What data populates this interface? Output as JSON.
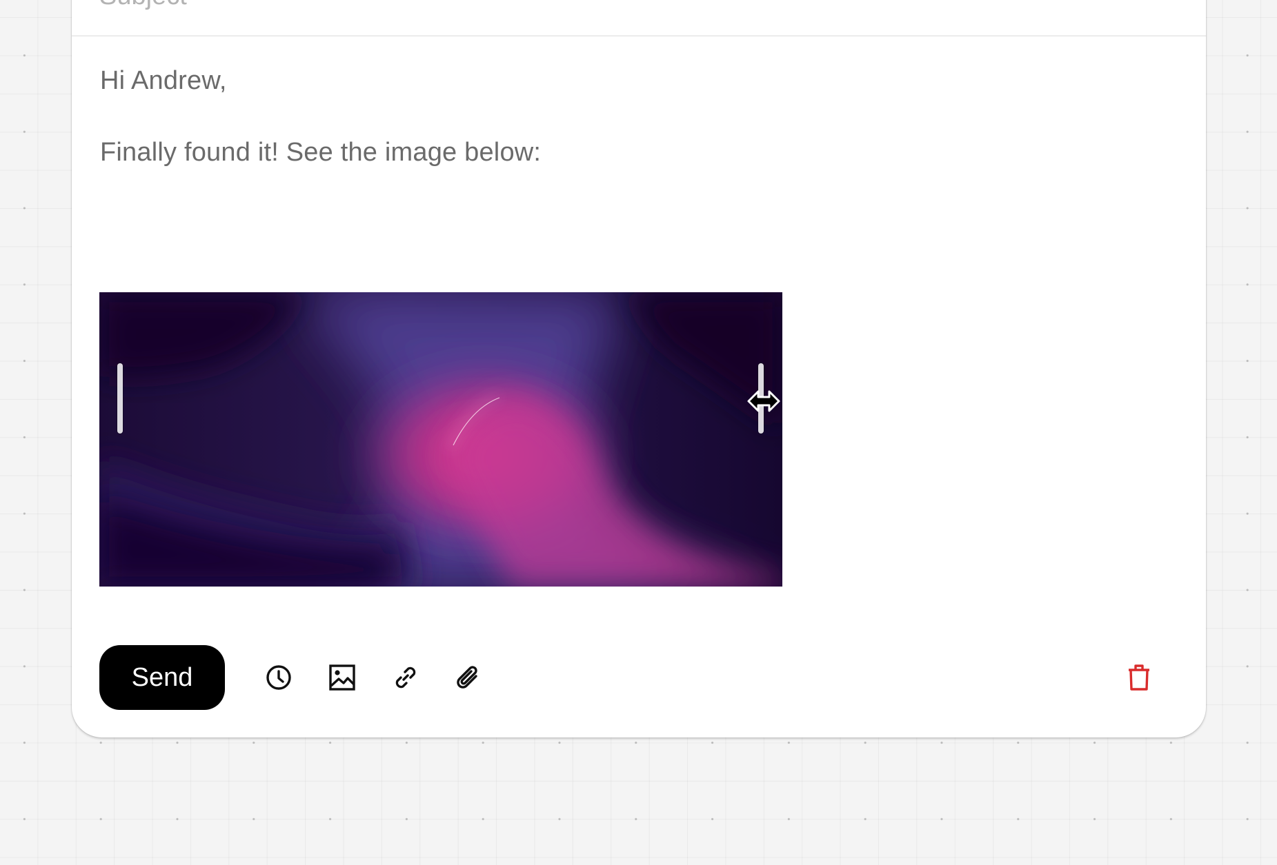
{
  "compose": {
    "subject_placeholder": "Subject",
    "greeting": "Hi Andrew,",
    "message": "Finally found it! See the image below:"
  },
  "inline_image": {
    "description_palette": [
      "#12052a",
      "#4e3c8f",
      "#e8328a"
    ]
  },
  "toolbar": {
    "send_label": "Send",
    "icons": [
      "clock-icon",
      "image-icon",
      "link-icon",
      "paperclip-icon",
      "trash-icon"
    ],
    "delete_color": "#d92c2c"
  }
}
